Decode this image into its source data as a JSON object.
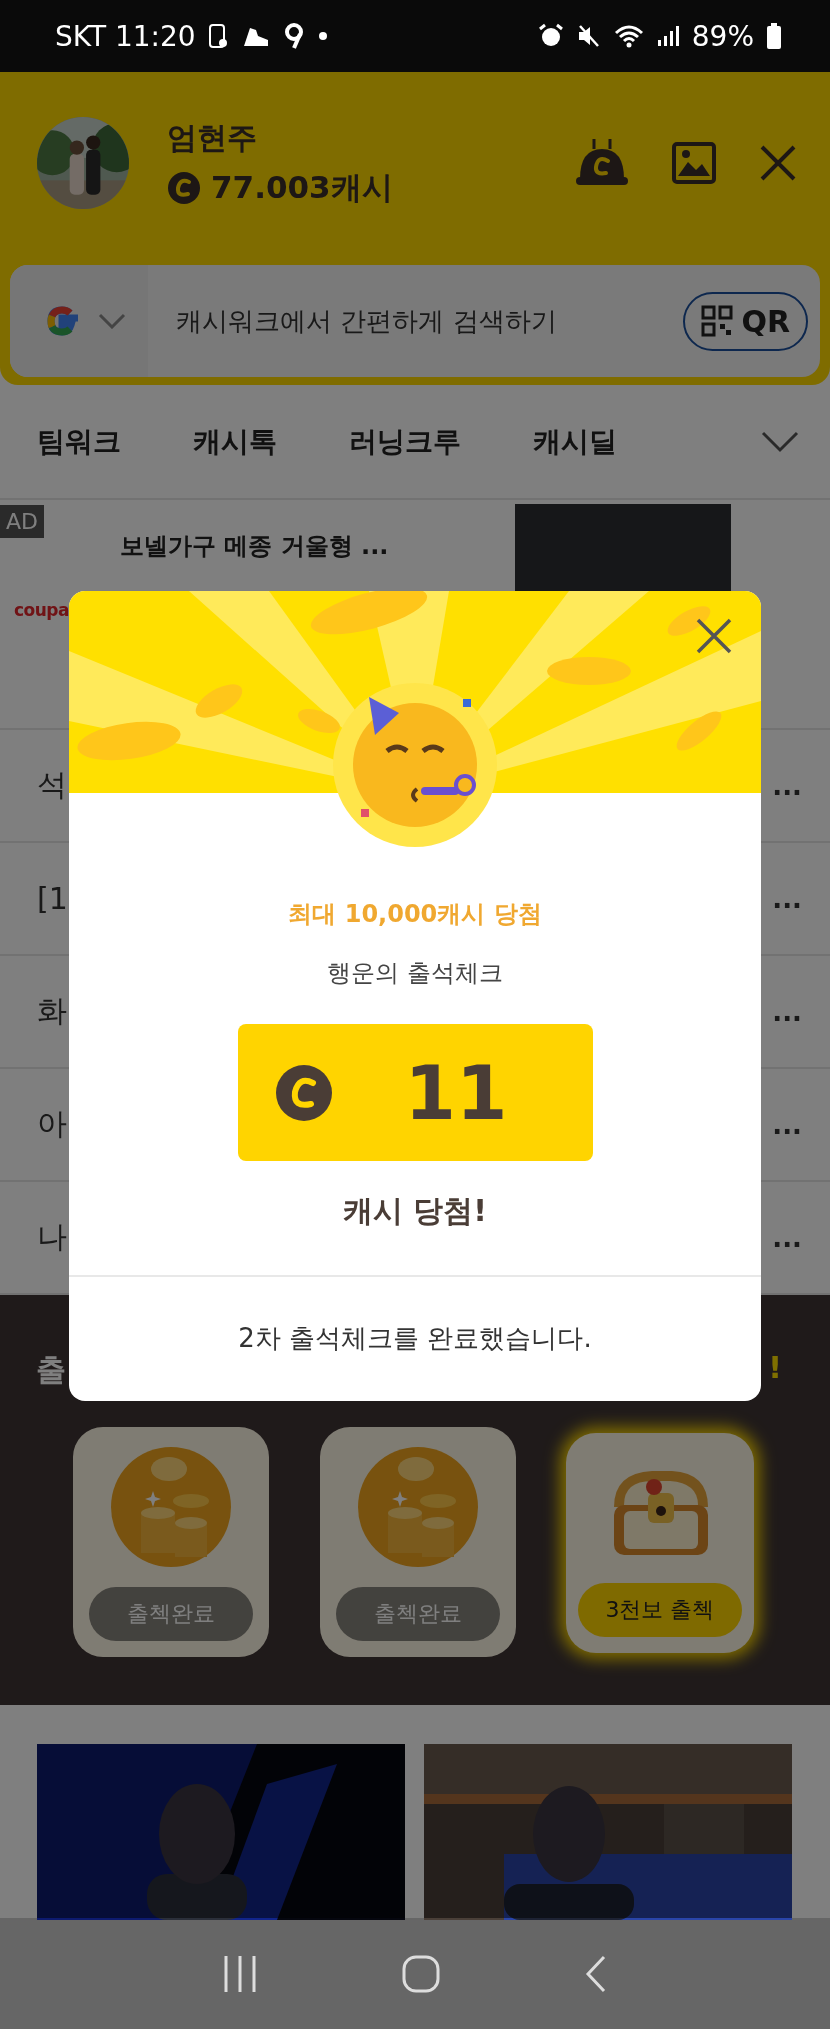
{
  "status_bar": {
    "carrier_time": "SKT 11:20",
    "battery": "89%"
  },
  "profile": {
    "name": "엄현주",
    "cash": "77.003캐시"
  },
  "search": {
    "placeholder": "캐시워크에서 간편하게 검색하기",
    "qr_label": "QR"
  },
  "tabs": [
    {
      "label": "팀워크",
      "selected": false
    },
    {
      "label": "캐시톡",
      "selected": false
    },
    {
      "label": "러닝크루",
      "selected": false
    },
    {
      "label": "캐시딜",
      "selected": false
    }
  ],
  "ad": {
    "badge": "AD",
    "title": "보넬가구 메종 거울형 ...",
    "brand": "coupa"
  },
  "news_rows": [
    {
      "start": "석",
      "end": "..."
    },
    {
      "start": "[1",
      "end": "..."
    },
    {
      "start": "화",
      "end": "..."
    },
    {
      "start": "아",
      "end": "..."
    },
    {
      "start": "나",
      "end": "..."
    }
  ],
  "attendance": {
    "title_start": "출",
    "title_end": "!",
    "cards": [
      {
        "kind": "coins",
        "label": "출첵완료",
        "done": true
      },
      {
        "kind": "coins",
        "label": "출첵완료",
        "done": true
      },
      {
        "kind": "chest",
        "label": "3천보 출첵",
        "done": false
      }
    ]
  },
  "modal": {
    "headline": "최대 10,000캐시 당첨",
    "subtitle": "행운의 출석체크",
    "amount": "11",
    "result": "캐시 당첨!",
    "message": "2차 출석체크를 완료했습니다."
  }
}
